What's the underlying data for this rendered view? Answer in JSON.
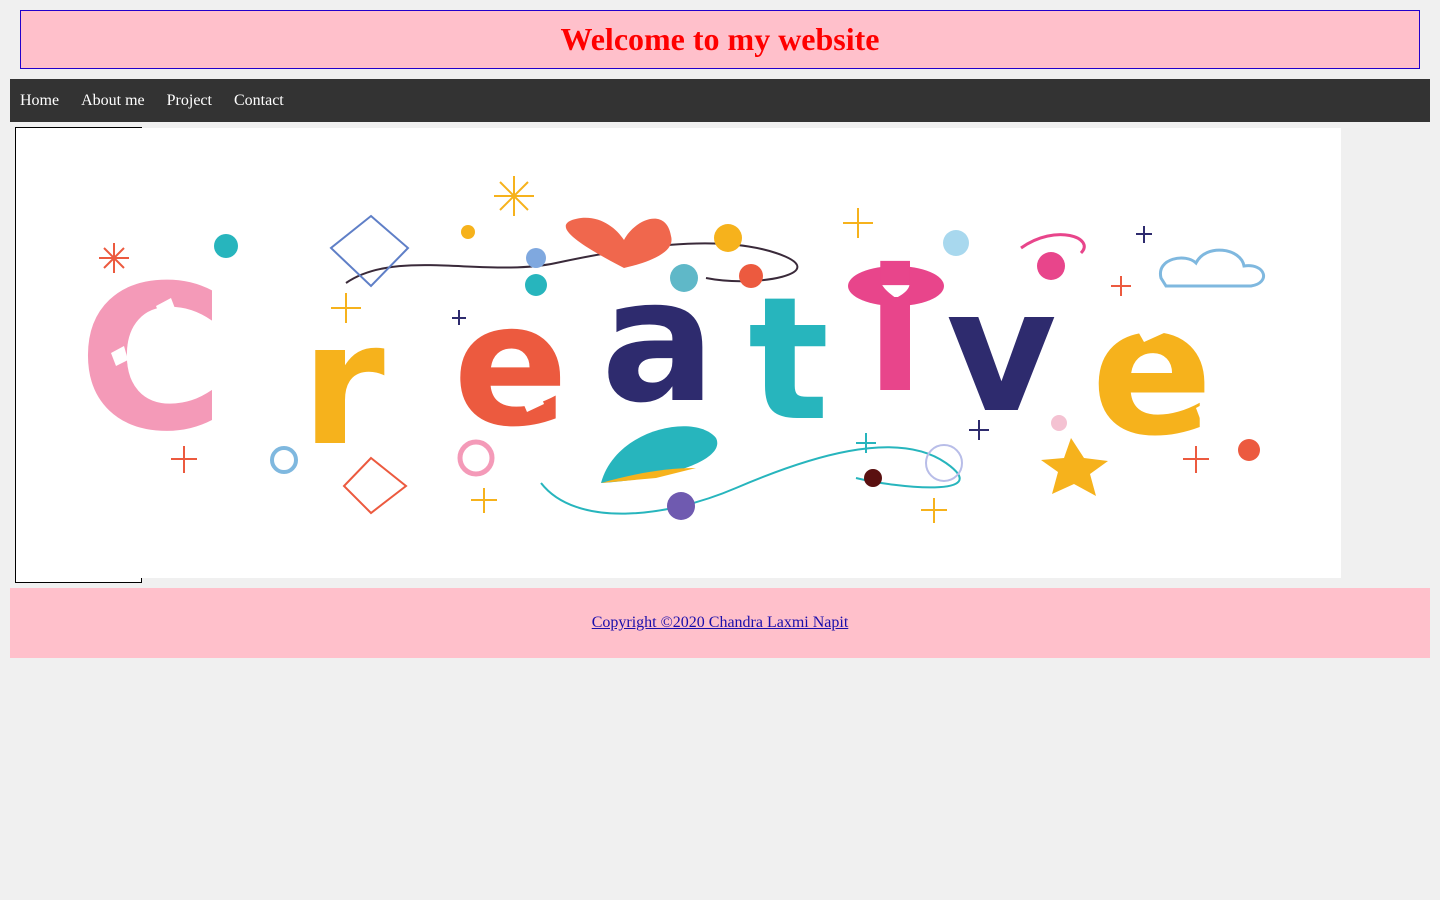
{
  "header": {
    "title": "Welcome to my website"
  },
  "nav": {
    "items": [
      {
        "label": "Home"
      },
      {
        "label": "About me"
      },
      {
        "label": "Project"
      },
      {
        "label": "Contact"
      }
    ]
  },
  "banner": {
    "word": "Creative",
    "letters": [
      "C",
      "r",
      "e",
      "a",
      "t",
      "i",
      "v",
      "e"
    ],
    "letter_colors": [
      "#f49ab8",
      "#f6b21c",
      "#ec5a3f",
      "#2e2b6e",
      "#27b5bd",
      "#e8458b",
      "#2e2b6e",
      "#f6b21c"
    ]
  },
  "footer": {
    "copyright": "Copyright ©2020 Chandra Laxmi Napit"
  },
  "colors": {
    "header_bg": "#ffc0cb",
    "header_text": "#ff0000",
    "nav_bg": "#333333",
    "footer_bg": "#ffc0cb",
    "link": "#1a0dab"
  }
}
